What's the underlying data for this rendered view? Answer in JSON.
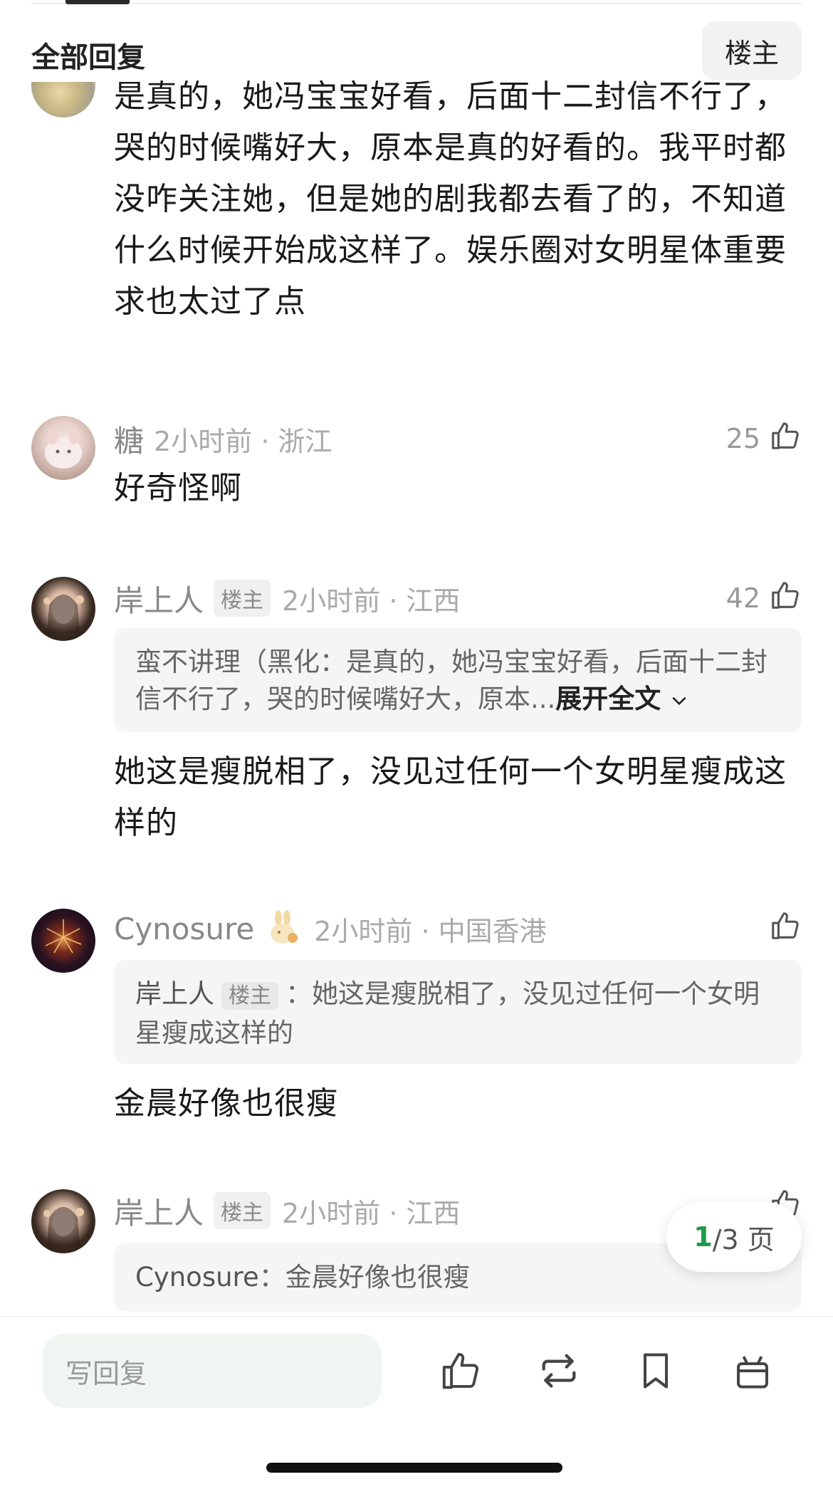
{
  "header": {
    "title": "全部回复",
    "op_filter": "楼主"
  },
  "comments": [
    {
      "text": "是真的，她冯宝宝好看，后面十二封信不行了，哭的时候嘴好大，原本是真的好看的。我平时都没咋关注她，但是她的剧我都去看了的，不知道什么时候开始成这样了。娱乐圈对女明星体重要求也太过了点"
    },
    {
      "name": "糖",
      "time": "2小时前 · 浙江",
      "likes": "25",
      "text": "好奇怪啊"
    },
    {
      "name": "岸上人",
      "badge": "楼主",
      "time": "2小时前 · 江西",
      "likes": "42",
      "quote_text": "蛮不讲理（黑化：是真的，她冯宝宝好看，后面十二封信不行了，哭的时候嘴好大，原本...",
      "quote_expand": "展开全文",
      "text": "她这是瘦脱相了，没见过任何一个女明星瘦成这样的"
    },
    {
      "name": "Cynosure",
      "time": "2小时前 · 中国香港",
      "quote_name": "岸上人",
      "quote_badge": "楼主",
      "quote_sep": "：",
      "quote_text": "她这是瘦脱相了，没见过任何一个女明星瘦成这样的",
      "text": "金晨好像也很瘦"
    },
    {
      "name": "岸上人",
      "badge": "楼主",
      "time": "2小时前 · 江西",
      "quote_name": "Cynosure",
      "quote_sep": "：",
      "quote_text": "金晨好像也很瘦"
    }
  ],
  "pager": {
    "current": "1",
    "total_label": "/3 页"
  },
  "bottom_bar": {
    "reply_placeholder": "写回复"
  },
  "icons": [
    "thumb-up-icon",
    "repost-icon",
    "bookmark-icon",
    "gift-icon",
    "chevron-down-icon",
    "rabbit-icon"
  ]
}
